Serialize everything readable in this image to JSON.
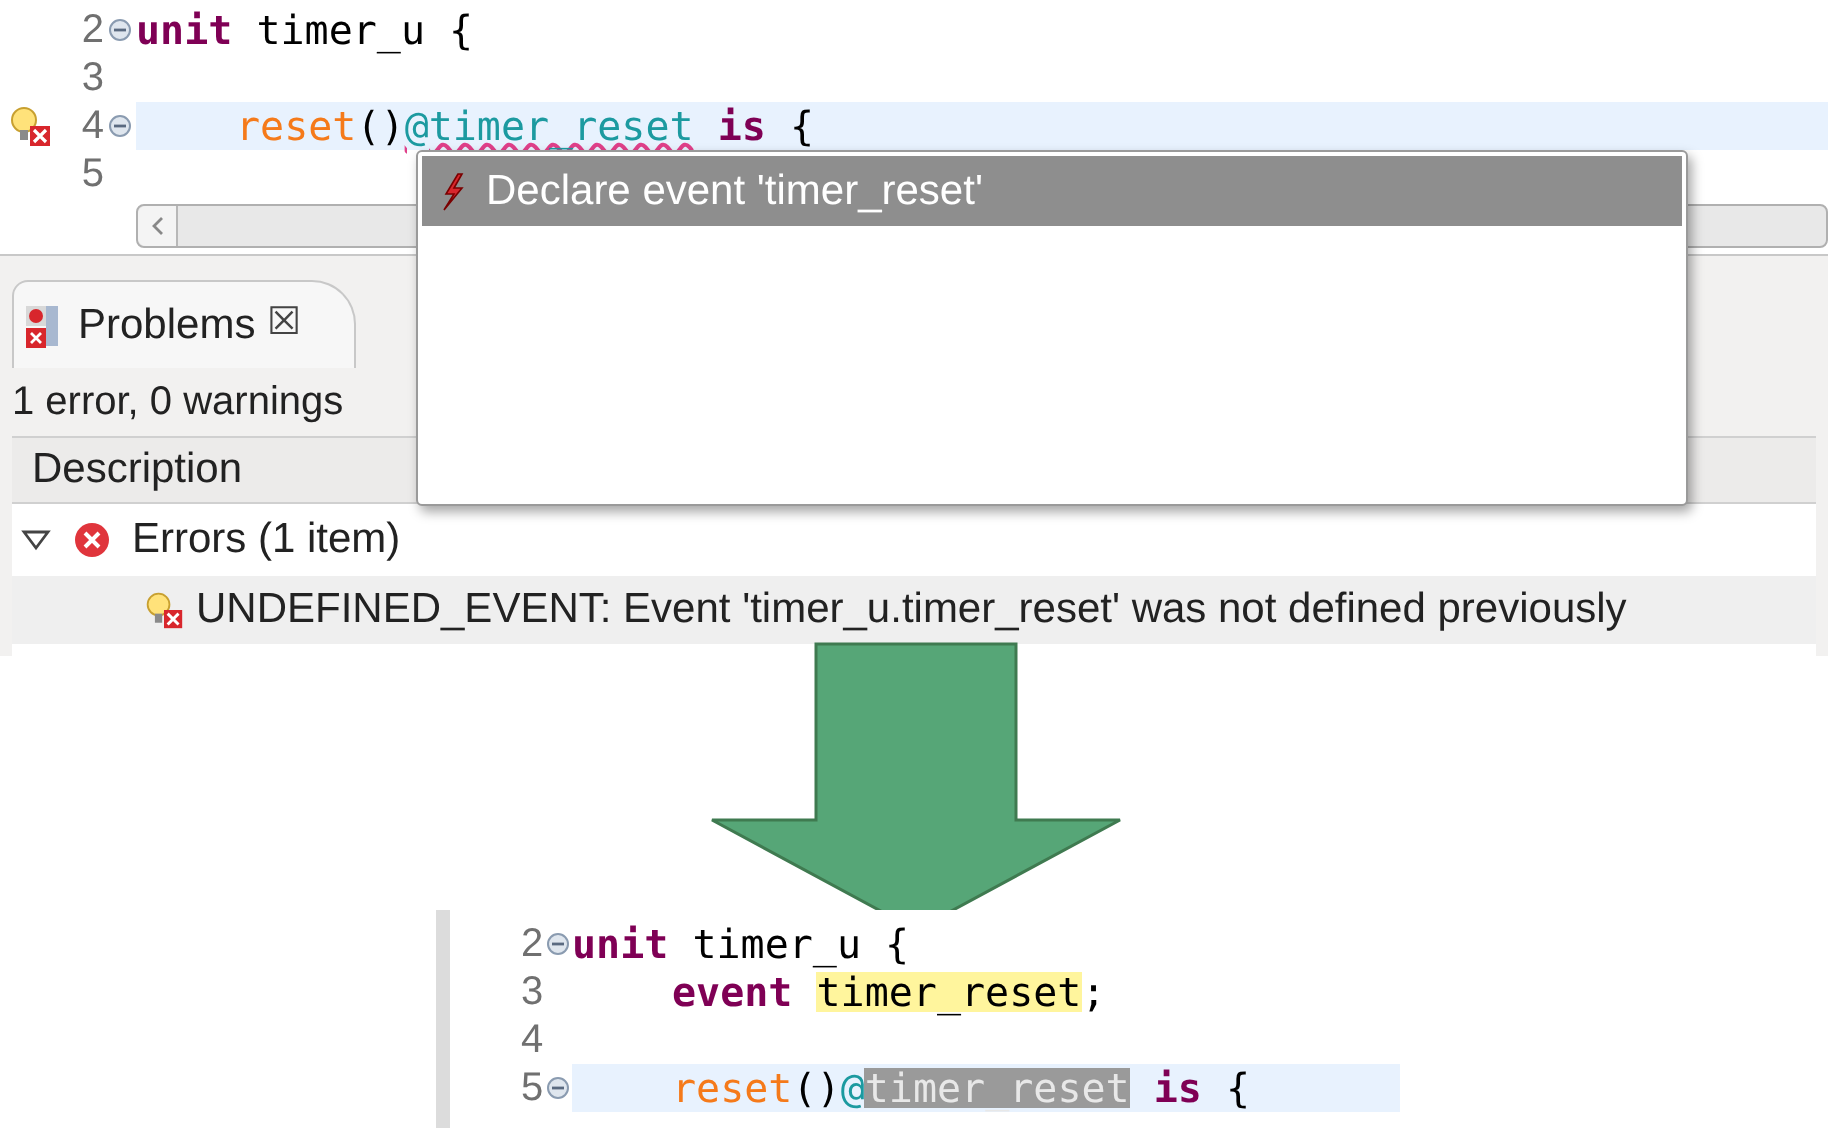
{
  "top_editor": {
    "lines": [
      {
        "number": "2",
        "fold": true,
        "marker": false,
        "current": false,
        "indented": false,
        "tokens": [
          {
            "text": "unit",
            "kind": "keyword"
          },
          {
            "text": " timer_u {",
            "kind": "plain"
          }
        ]
      },
      {
        "number": "3",
        "fold": false,
        "marker": false,
        "current": false
      },
      {
        "number": "4",
        "fold": true,
        "marker": true,
        "current": true,
        "indented": true,
        "tokens": [
          {
            "text": "reset",
            "kind": "method"
          },
          {
            "text": "()",
            "kind": "plain"
          },
          {
            "text": "@timer_reset",
            "kind": "error_ref"
          },
          {
            "text": " is",
            "kind": "keyword"
          },
          {
            "text": " {",
            "kind": "plain"
          }
        ]
      },
      {
        "number": "5",
        "fold": false,
        "marker": false,
        "current": false
      }
    ]
  },
  "quick_fix_popup": {
    "proposals": [
      {
        "label": "Declare event 'timer_reset'",
        "selected": true
      }
    ]
  },
  "problems_view": {
    "tab": {
      "label": "Problems",
      "close": "☒"
    },
    "summary": "1 error, 0 warnings",
    "columns": [
      "Description"
    ],
    "tree": [
      {
        "label": "Errors (1 item)",
        "expanded": true,
        "children": [
          {
            "label": "UNDEFINED_EVENT: Event 'timer_u.timer_reset' was not defined previously"
          }
        ]
      }
    ]
  },
  "bottom_editor": {
    "lines": [
      {
        "number": "2",
        "fold": true,
        "current": false,
        "indented": false,
        "tokens": [
          {
            "text": "unit",
            "kind": "keyword"
          },
          {
            "text": " timer_u {",
            "kind": "plain"
          }
        ]
      },
      {
        "number": "3",
        "fold": false,
        "current": false,
        "indented": true,
        "tokens": [
          {
            "text": "event ",
            "kind": "keyword"
          },
          {
            "text": "timer_reset",
            "kind": "highlight"
          },
          {
            "text": ";",
            "kind": "plain"
          }
        ]
      },
      {
        "number": "4",
        "fold": false,
        "current": false
      },
      {
        "number": "5",
        "fold": true,
        "current": true,
        "indented": true,
        "tokens": [
          {
            "text": "reset",
            "kind": "method"
          },
          {
            "text": "()",
            "kind": "plain"
          },
          {
            "text": "@",
            "kind": "event"
          },
          {
            "text": "timer_reset",
            "kind": "selection"
          },
          {
            "text": " is",
            "kind": "keyword"
          },
          {
            "text": " {",
            "kind": "plain"
          }
        ]
      }
    ]
  }
}
